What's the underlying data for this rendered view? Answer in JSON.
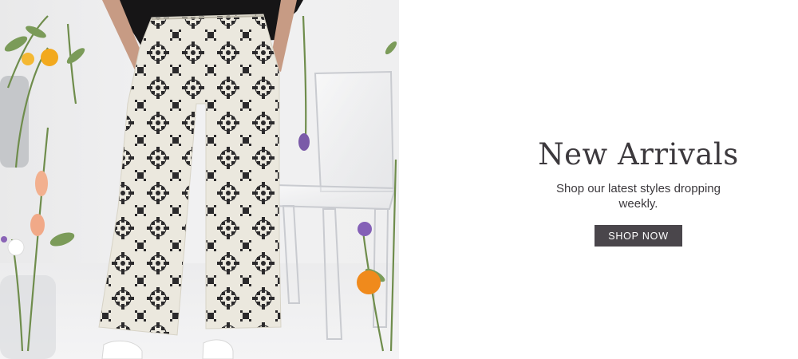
{
  "banner": {
    "heading": "New Arrivals",
    "subtext": "Shop our latest styles dropping weekly.",
    "button_label": "SHOP NOW"
  },
  "colors": {
    "text": "#3c393d",
    "button_bg": "#4a464b",
    "button_text": "#ffffff",
    "background": "#ffffff"
  },
  "image": {
    "subject": "model-wearing-printed-wide-leg-pants"
  }
}
